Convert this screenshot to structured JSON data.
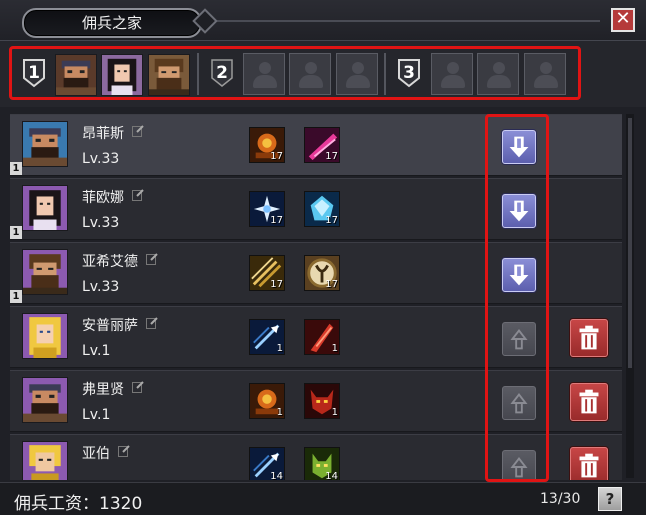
{
  "window": {
    "title": "佣兵之家",
    "close_glyph": "✕"
  },
  "teams": [
    {
      "number": "1",
      "members": [
        "bearded-warrior-portrait",
        "dark-hair-woman-portrait",
        "brown-hair-warrior-portrait"
      ]
    },
    {
      "number": "2",
      "members": [
        "",
        "",
        ""
      ]
    },
    {
      "number": "3",
      "members": [
        "",
        "",
        ""
      ]
    }
  ],
  "mercenaries": [
    {
      "name": "昂菲斯",
      "level": "Lv.33",
      "team": "1",
      "skills": [
        {
          "icon": "fire-skull-skill",
          "count": "17"
        },
        {
          "icon": "pink-slash-skill",
          "count": "17"
        }
      ],
      "action": "down",
      "deletable": false
    },
    {
      "name": "菲欧娜",
      "level": "Lv.33",
      "team": "1",
      "skills": [
        {
          "icon": "star-burst-skill",
          "count": "17"
        },
        {
          "icon": "ice-crystal-skill",
          "count": "17"
        }
      ],
      "action": "down",
      "deletable": false
    },
    {
      "name": "亚希艾德",
      "level": "Lv.33",
      "team": "1",
      "skills": [
        {
          "icon": "triple-arrow-skill",
          "count": "17"
        },
        {
          "icon": "gold-rune-skill",
          "count": "17"
        }
      ],
      "action": "down",
      "deletable": false
    },
    {
      "name": "安普丽萨",
      "level": "Lv.1",
      "team": "",
      "skills": [
        {
          "icon": "blue-arrow-skill",
          "count": "1"
        },
        {
          "icon": "red-slash-skill",
          "count": "1"
        }
      ],
      "action": "up",
      "deletable": true
    },
    {
      "name": "弗里贤",
      "level": "Lv.1",
      "team": "",
      "skills": [
        {
          "icon": "fire-skull-skill",
          "count": "1"
        },
        {
          "icon": "red-demon-skill",
          "count": "1"
        }
      ],
      "action": "up",
      "deletable": true
    },
    {
      "name": "亚伯",
      "level": "",
      "team": "",
      "skills": [
        {
          "icon": "blue-arrow-skill",
          "count": "14"
        },
        {
          "icon": "green-beast-skill",
          "count": "14"
        }
      ],
      "action": "up",
      "deletable": true
    }
  ],
  "footer": {
    "wage_label": "佣兵工资：1320",
    "count": "13/30",
    "help": "?"
  }
}
